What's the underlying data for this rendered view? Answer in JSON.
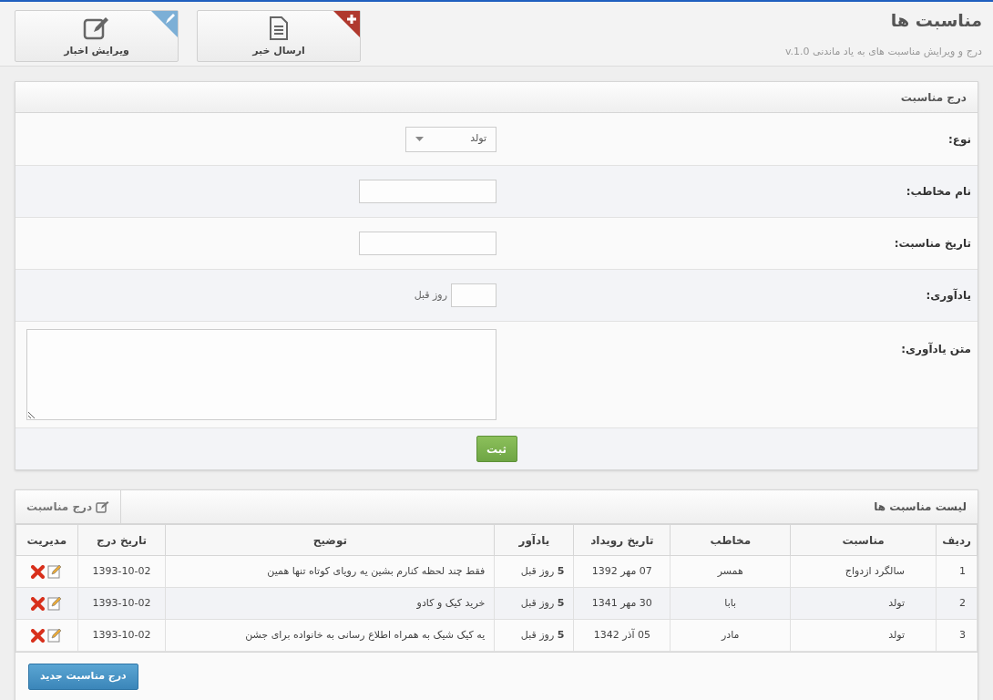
{
  "header": {
    "title": "مناسبت ها",
    "subtitle": "درج و ویرایش مناسبت های به یاد ماندنی v.1.0"
  },
  "shortcuts": [
    {
      "label": "ارسال خبر",
      "kind": "add"
    },
    {
      "label": "ویرایش اخبار",
      "kind": "edit"
    }
  ],
  "form": {
    "title": "درج مناسبت",
    "fields": [
      {
        "kind": "select",
        "label": "نوع:",
        "value": "تولد"
      },
      {
        "kind": "text",
        "label": "نام مخاطب:"
      },
      {
        "kind": "text",
        "label": "تاریخ مناسبت:"
      },
      {
        "kind": "days",
        "label": "یادآوری:",
        "suffix": "روز قبل"
      },
      {
        "kind": "textarea",
        "label": "متن یادآوری:"
      }
    ],
    "submit": "ثبت"
  },
  "list": {
    "title": "لیست مناسبت ها",
    "tab": "درج مناسبت",
    "columns": [
      "ردیف",
      "مناسبت",
      "مخاطب",
      "تاریخ رویداد",
      "یادآور",
      "توضیح",
      "تاریخ درج",
      "مدیریت"
    ],
    "rows": [
      {
        "cells": [
          "1",
          "سالگرد ازدواج",
          "همسر",
          "07 مهر 1392",
          "**5** روز قبل",
          "فقط چند لحظه کنارم بشین یه رویای کوتاه تنها همین",
          "1393-10-02"
        ]
      },
      {
        "cells": [
          "2",
          "تولد",
          "بابا",
          "30 مهر 1341",
          "**5** روز قبل",
          "خرید کیک و کادو",
          "1393-10-02"
        ]
      },
      {
        "cells": [
          "3",
          "تولد",
          "مادر",
          "05 آذر 1342",
          "**5** روز قبل",
          "یه کیک شیک به همراه اطلاع رسانی به خانواده برای جشن",
          "1393-10-02"
        ]
      }
    ],
    "new_button": "درج مناسبت جدید"
  }
}
